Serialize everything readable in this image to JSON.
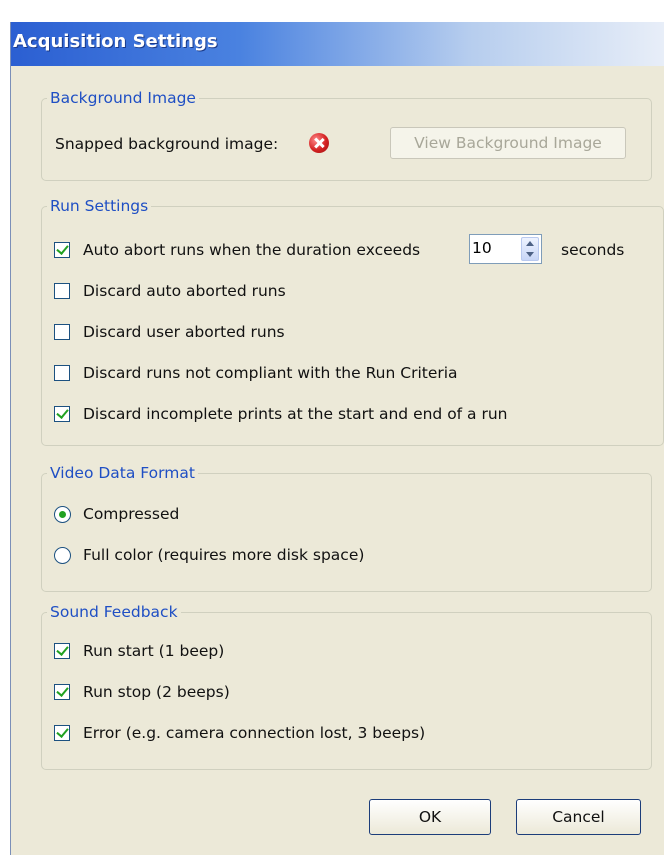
{
  "window": {
    "title": "Acquisition Settings"
  },
  "background_image": {
    "legend": "Background Image",
    "label": "Snapped background image:",
    "status_icon": "error-icon",
    "view_button": "View Background Image"
  },
  "run_settings": {
    "legend": "Run Settings",
    "auto_abort": {
      "label_before": "Auto abort runs when the duration exceeds",
      "value": "10",
      "label_after": "seconds",
      "checked": true
    },
    "options": [
      {
        "label": "Discard auto aborted runs",
        "checked": false
      },
      {
        "label": "Discard user aborted runs",
        "checked": false
      },
      {
        "label": "Discard runs not compliant with the Run Criteria",
        "checked": false
      },
      {
        "label": "Discard incomplete prints at the start and end of a run",
        "checked": true
      }
    ]
  },
  "video_format": {
    "legend": "Video Data Format",
    "options": [
      {
        "label": "Compressed",
        "selected": true
      },
      {
        "label": "Full color (requires more disk space)",
        "selected": false
      }
    ]
  },
  "sound_feedback": {
    "legend": "Sound Feedback",
    "options": [
      {
        "label": "Run start (1 beep)",
        "checked": true
      },
      {
        "label": "Run stop (2 beeps)",
        "checked": true
      },
      {
        "label": "Error (e.g. camera connection lost, 3 beeps)",
        "checked": true
      }
    ]
  },
  "buttons": {
    "ok": "OK",
    "cancel": "Cancel"
  },
  "colors": {
    "legend_text": "#1f4fc4",
    "check_mark": "#21a121",
    "dialog_bg": "#ece9d8"
  }
}
